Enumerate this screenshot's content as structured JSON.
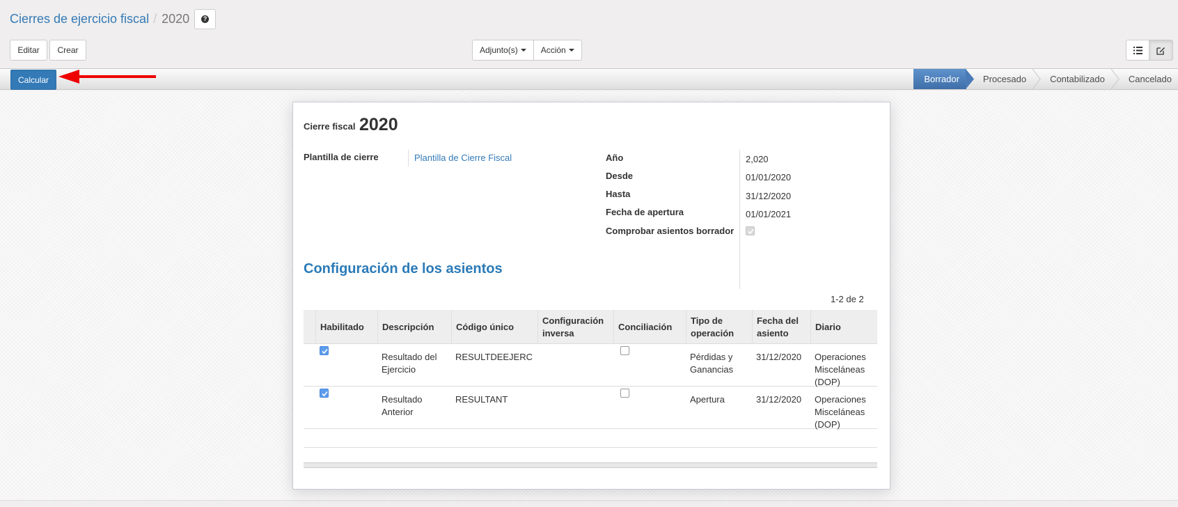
{
  "breadcrumb": {
    "parent": "Cierres de ejercicio fiscal",
    "separator": "/",
    "current": "2020"
  },
  "help_button": {
    "icon": "question-circle-icon"
  },
  "buttons": {
    "edit": "Editar",
    "create": "Crear",
    "attachments": "Adjunto(s)",
    "action": "Acción"
  },
  "view_switch": {
    "list_icon": "list-icon",
    "form_icon": "edit-icon",
    "active": "form"
  },
  "statusbar": {
    "primary_button": "Calcular",
    "states": [
      "Borrador",
      "Procesado",
      "Contabilizado",
      "Cancelado"
    ],
    "current_state": "Borrador"
  },
  "form": {
    "title_label": "Cierre fiscal",
    "title_value": "2020",
    "left_fields": [
      {
        "label": "Plantilla de cierre",
        "value": "Plantilla de Cierre Fiscal"
      }
    ],
    "right_fields": [
      {
        "label": "Año",
        "value": "2,020"
      },
      {
        "label": "Desde",
        "value": "01/01/2020"
      },
      {
        "label": "Hasta",
        "value": "31/12/2020"
      },
      {
        "label": "Fecha de apertura",
        "value": "01/01/2021"
      },
      {
        "label": "Comprobar asientos borrador",
        "checked": true
      }
    ],
    "section_title": "Configuración de los asientos",
    "pager": "1-2 de 2",
    "table": {
      "headers": [
        "Habilitado",
        "Descripción",
        "Código único",
        "Configuración inversa",
        "Conciliación",
        "Tipo de operación",
        "Fecha del asiento",
        "Diario"
      ],
      "rows": [
        {
          "enabled": true,
          "description": "Resultado del Ejercicio",
          "code": "RESULTDEEJERC",
          "inverse": "",
          "reconcile": false,
          "operation": "Pérdidas y Ganancias",
          "date": "31/12/2020",
          "journal": "Operaciones Misceláneas (DOP)"
        },
        {
          "enabled": true,
          "description": "Resultado Anterior",
          "code": "RESULTANT",
          "inverse": "",
          "reconcile": false,
          "operation": "Apertura",
          "date": "31/12/2020",
          "journal": "Operaciones Misceláneas (DOP)"
        }
      ]
    }
  },
  "colors": {
    "primary": "#337ab7",
    "status_current": "#4f82bf",
    "annotation_arrow": "#ee0000",
    "section_title": "#2a7ab8"
  }
}
